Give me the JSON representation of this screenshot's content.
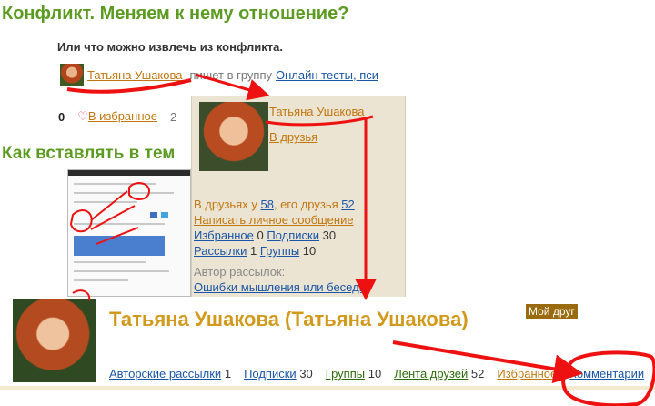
{
  "post": {
    "title": "Конфликт. Меняем к нему отношение?",
    "subtitle": "Или что можно извлечь из конфликта.",
    "author": "Татьяна Ушакова",
    "meta_text": "пишет в группу",
    "group": "Онлайн тесты, пси",
    "count": "0",
    "favorite_label": "В избранное",
    "favorite_tail": "2"
  },
  "post2": {
    "title": "Как вставлять в тем"
  },
  "popup": {
    "name": "Татьяна Ушакова",
    "add_friend": "В друзья",
    "friends_prefix": "В друзьях у",
    "friends_count": "58",
    "friends_mid": ", его друзья",
    "his_friends": "52",
    "write_message": "Написать личное сообщение",
    "favorites": "Избранное",
    "favorites_count": "0",
    "subscriptions": "Подписки",
    "subscriptions_count": "30",
    "mailings": "Рассылки",
    "mailings_count": "1",
    "groups": "Группы",
    "groups_count": "10",
    "author_of": "Автор рассылок:",
    "mailing_name": "Ошибки мышления или беседы"
  },
  "profile": {
    "title": "Татьяна Ушакова (Татьяна Ушакова)",
    "badge": "Мой друг",
    "nav": [
      {
        "label": "Авторские рассылки",
        "count": "1"
      },
      {
        "label": "Подписки",
        "count": "30"
      },
      {
        "label": "Группы",
        "count": "10"
      },
      {
        "label": "Лента друзей",
        "count": "52"
      },
      {
        "label": "Избранное",
        "count": ""
      },
      {
        "label": "Комментарии",
        "count": ""
      }
    ]
  },
  "colors": {
    "title_green": "#5c9b21",
    "link_orange": "#c0770f",
    "link_blue": "#1a56a8",
    "popup_bg": "#ece4d2",
    "annotation_red": "#ee1111"
  }
}
